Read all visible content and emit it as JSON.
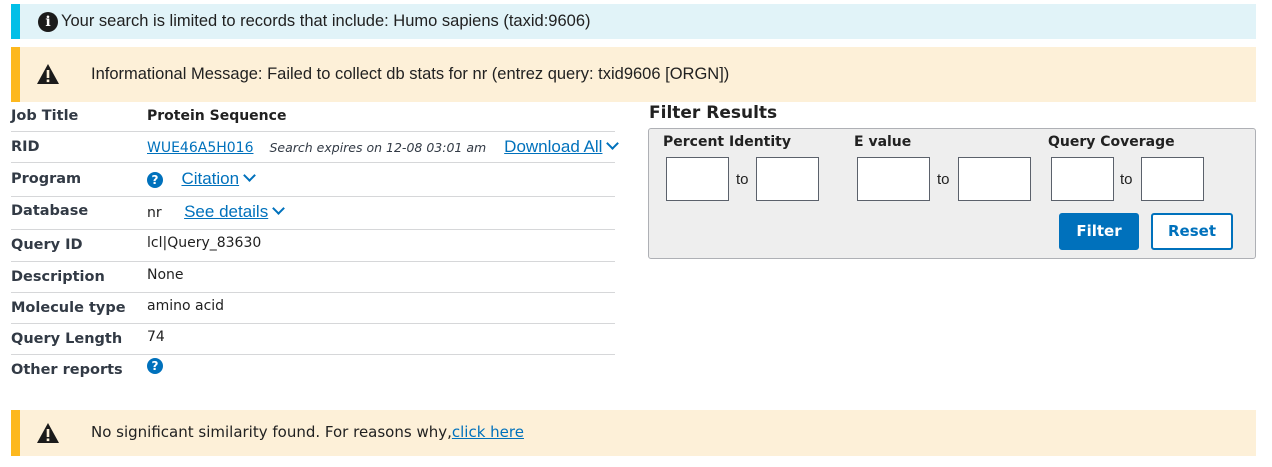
{
  "info_banner": {
    "text": "Your search is limited to records that include: Humo sapiens (taxid:9606)"
  },
  "warning_banner": {
    "text": "Informational Message: Failed to collect db stats for nr (entrez query: txid9606 [ORGN])"
  },
  "summary": {
    "job_title": {
      "label": "Job Title",
      "value": "Protein Sequence"
    },
    "rid": {
      "label": "RID",
      "value": "WUE46A5H016",
      "expires": "Search expires on 12-08 03:01 am",
      "download": "Download All"
    },
    "program": {
      "label": "Program",
      "citation": "Citation"
    },
    "database": {
      "label": "Database",
      "value": "nr",
      "details": "See details"
    },
    "query_id": {
      "label": "Query ID",
      "value": "lcl|Query_83630"
    },
    "description": {
      "label": "Description",
      "value": "None"
    },
    "molecule_type": {
      "label": "Molecule type",
      "value": "amino acid"
    },
    "query_length": {
      "label": "Query Length",
      "value": "74"
    },
    "other_reports": {
      "label": "Other reports"
    }
  },
  "filter": {
    "title": "Filter Results",
    "percent_identity": {
      "label": "Percent Identity",
      "to": "to",
      "from_value": "",
      "to_value": ""
    },
    "e_value": {
      "label": "E value",
      "to": "to",
      "from_value": "",
      "to_value": ""
    },
    "query_coverage": {
      "label": "Query Coverage",
      "to": "to",
      "from_value": "",
      "to_value": ""
    },
    "filter_button": "Filter",
    "reset_button": "Reset"
  },
  "no_results": {
    "text": "No significant similarity found. For reasons why,",
    "link": "click here"
  },
  "icons": {
    "info": "info-icon",
    "warning": "warning-icon",
    "help": "help-icon",
    "chevron": "chevron-down-icon"
  },
  "colors": {
    "accent": "#0071bc",
    "info_bg": "#e1f3f8",
    "info_bar": "#02bfe7",
    "warn_bg": "#fdf0d8",
    "warn_bar": "#fdb81e"
  }
}
